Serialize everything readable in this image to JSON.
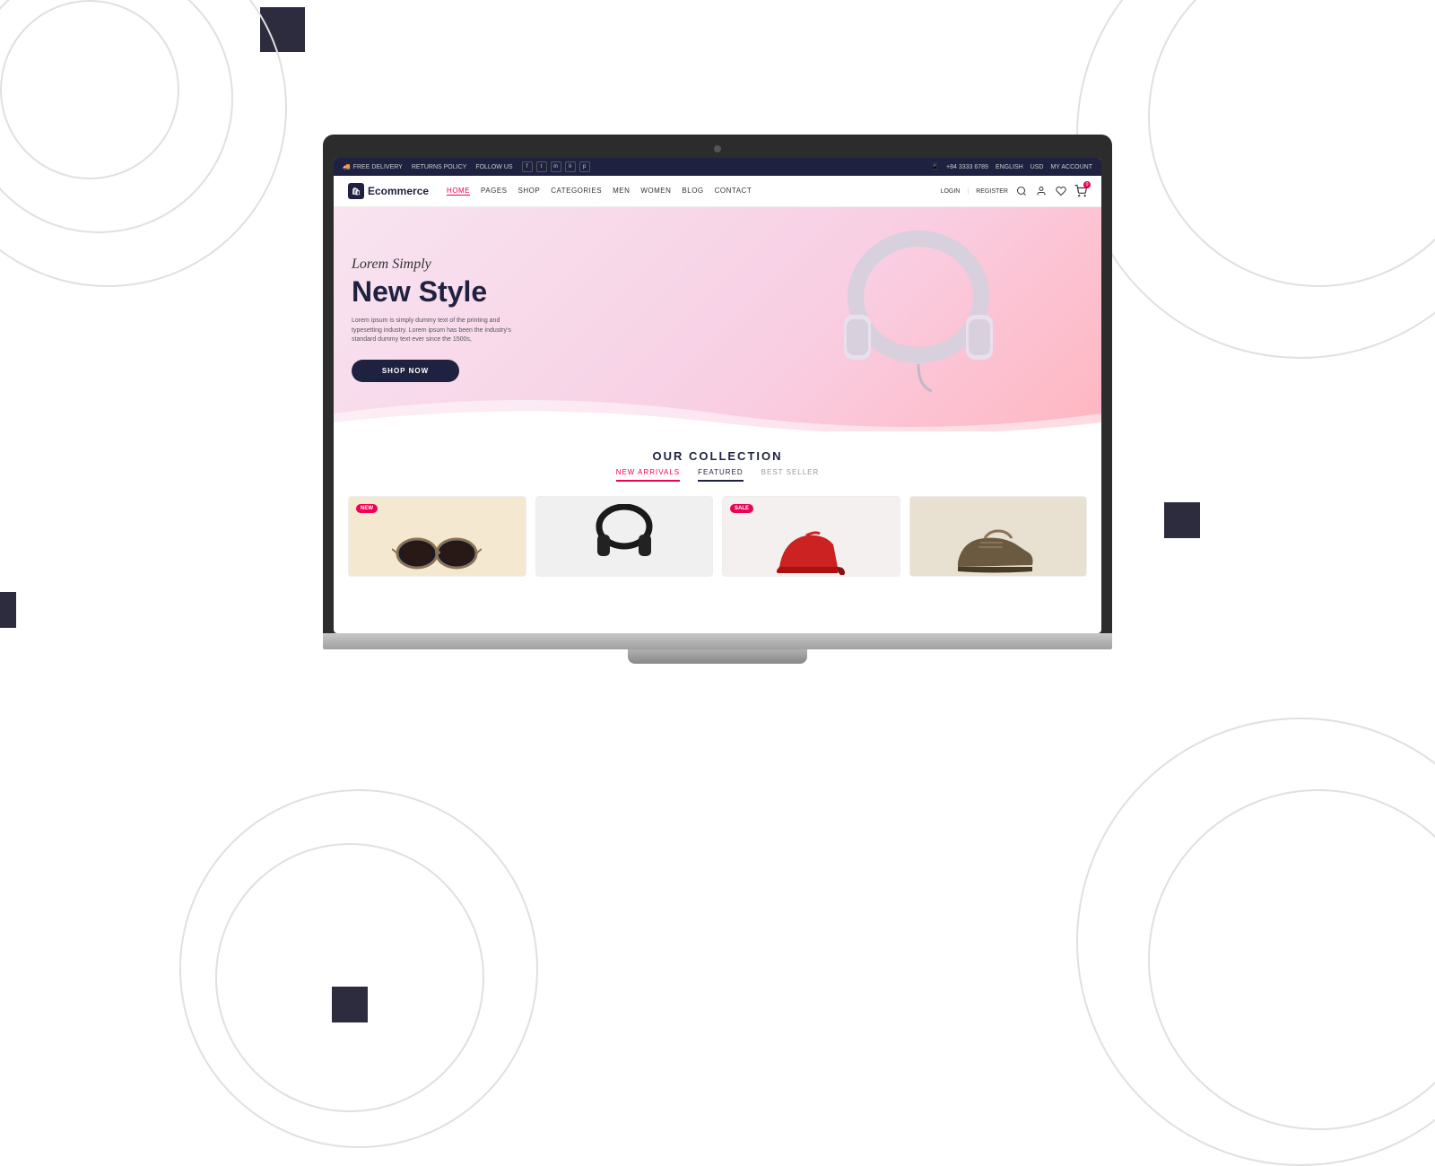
{
  "page": {
    "background_color": "#ffffff"
  },
  "topbar": {
    "free_delivery": "FREE DELIVERY",
    "returns_policy": "RETURNS POLICY",
    "follow_us": "FOLLOW US",
    "phone": "+84 3333 6789",
    "language": "ENGLISH",
    "currency": "USD",
    "my_account": "MY ACCOUNT",
    "social_icons": [
      "f",
      "t",
      "in",
      "in",
      "p"
    ]
  },
  "nav": {
    "logo_text": "Ecommerce",
    "links": [
      {
        "label": "HOME",
        "active": true
      },
      {
        "label": "PAGES",
        "active": false
      },
      {
        "label": "SHOP",
        "active": false
      },
      {
        "label": "CATEGORIES",
        "active": false
      },
      {
        "label": "MEN",
        "active": false
      },
      {
        "label": "WOMEN",
        "active": false
      },
      {
        "label": "BLOG",
        "active": false
      },
      {
        "label": "CONTACT",
        "active": false
      }
    ],
    "login": "LOGIN",
    "register": "REGISTER",
    "cart_count": "0"
  },
  "hero": {
    "script_text": "Lorem Simply",
    "title": "New Style",
    "description": "Lorem ipsum is simply dummy text of the printing and typesetting industry. Lorem ipsum has been the industry's standard dummy text ever since the 1500s,",
    "button_label": "SHOP NOW",
    "accent_color": "#e05050"
  },
  "collection": {
    "section_title": "OUR COLLECTION",
    "tabs": [
      {
        "label": "NEW ARRIVALS",
        "active": true,
        "style": "orange"
      },
      {
        "label": "FEATURED",
        "active": false,
        "style": "dark"
      },
      {
        "label": "BEST SELLER",
        "active": false,
        "style": "normal"
      }
    ],
    "products": [
      {
        "badge": "NEW",
        "badge_color": "#e05050",
        "type": "sunglasses",
        "bg": "#f5e8d0"
      },
      {
        "badge": null,
        "type": "headphones",
        "bg": "#f0f0f0"
      },
      {
        "badge": "SALE",
        "badge_color": "#e05050",
        "type": "heels",
        "bg": "#f0eeee"
      },
      {
        "badge": null,
        "type": "shoes",
        "bg": "#e8e0d0"
      }
    ]
  },
  "decorations": {
    "squares": [
      {
        "pos": "top-left",
        "color": "#2c2c3e"
      },
      {
        "pos": "middle-right",
        "color": "#2c2c3e"
      },
      {
        "pos": "bottom-left",
        "color": "#2c2c3e"
      }
    ]
  }
}
